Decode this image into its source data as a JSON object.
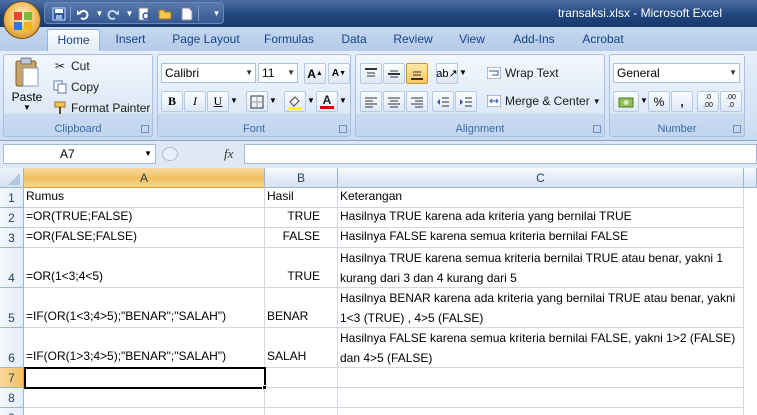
{
  "window": {
    "title": "transaksi.xlsx - Microsoft Excel",
    "controls": [
      "minimize",
      "maximize",
      "close"
    ]
  },
  "quick_access": [
    "save-icon",
    "undo-icon",
    "redo-icon",
    "print-preview-icon",
    "open-icon",
    "new-icon",
    "customize-icon"
  ],
  "tabs": [
    {
      "label": "Home",
      "active": true
    },
    {
      "label": "Insert"
    },
    {
      "label": "Page Layout"
    },
    {
      "label": "Formulas"
    },
    {
      "label": "Data"
    },
    {
      "label": "Review"
    },
    {
      "label": "View"
    },
    {
      "label": "Add-Ins"
    },
    {
      "label": "Acrobat"
    }
  ],
  "ribbon": {
    "clipboard": {
      "label": "Clipboard",
      "paste": "Paste",
      "cut": "Cut",
      "copy": "Copy",
      "format_painter": "Format Painter"
    },
    "font": {
      "label": "Font",
      "name": "Calibri",
      "size": "11",
      "grow": "A",
      "shrink": "A",
      "bold": "B",
      "italic": "I",
      "underline": "U",
      "font_color": "A"
    },
    "alignment": {
      "label": "Alignment",
      "wrap_text": "Wrap Text",
      "merge_center": "Merge & Center"
    },
    "number": {
      "label": "Number",
      "format": "General",
      "percent": "%",
      "comma": ",",
      "inc_decimal": ".0\n.00",
      "dec_decimal": ".00\n.0"
    }
  },
  "formula_bar": {
    "name_box": "A7",
    "fx": "fx",
    "formula": ""
  },
  "colors": {
    "accent": "#f1c15f",
    "ribbon_text": "#15428b",
    "grid_line": "#d0d7e5"
  },
  "sheet": {
    "columns": [
      "A",
      "B",
      "C"
    ],
    "selected_column": "A",
    "selected_row": "7",
    "rows": [
      {
        "num": "1",
        "A": "Rumus",
        "B": "Hasil",
        "C": "Keterangan"
      },
      {
        "num": "2",
        "A": "=OR(TRUE;FALSE)",
        "B": "TRUE",
        "C": "Hasilnya TRUE karena ada kriteria yang bernilai TRUE"
      },
      {
        "num": "3",
        "A": "=OR(FALSE;FALSE)",
        "B": "FALSE",
        "C": "Hasilnya FALSE karena semua kriteria bernilai FALSE"
      },
      {
        "num": "4",
        "A": "=OR(1<3;4<5)",
        "B": "TRUE",
        "C": "Hasilnya TRUE karena semua kriteria bernilai TRUE atau benar, yakni 1 kurang dari 3 dan 4 kurang dari 5"
      },
      {
        "num": "5",
        "A": "=IF(OR(1<3;4>5);\"BENAR\";\"SALAH\")",
        "B": "BENAR",
        "C": "Hasilnya BENAR karena ada kriteria yang bernilai TRUE atau benar, yakni 1<3 (TRUE) , 4>5 (FALSE)"
      },
      {
        "num": "6",
        "A": "=IF(OR(1>3;4>5);\"BENAR\";\"SALAH\")",
        "B": "SALAH",
        "C": "Hasilnya FALSE karena semua kriteria bernilai FALSE, yakni 1>2 (FALSE) dan 4>5 (FALSE)"
      },
      {
        "num": "7",
        "A": "",
        "B": "",
        "C": ""
      },
      {
        "num": "8",
        "A": "",
        "B": "",
        "C": ""
      },
      {
        "num": "9",
        "A": "",
        "B": "",
        "C": ""
      }
    ]
  }
}
